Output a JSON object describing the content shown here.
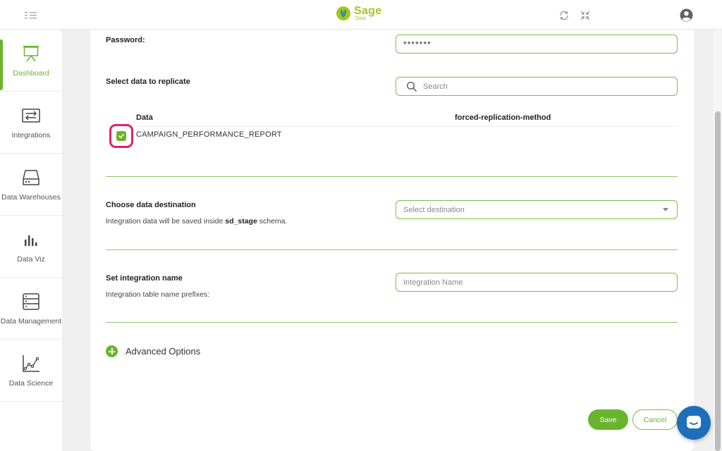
{
  "app": {
    "logo_name": "Sage",
    "logo_sub": "Data",
    "brand_color": "#a9c41e",
    "accent_color": "#6ab42d"
  },
  "topbar": {
    "icons": [
      "menu-icon",
      "refresh-icon",
      "collapse-icon",
      "user-avatar-icon"
    ]
  },
  "sidebar": {
    "items": [
      {
        "label": "Dashboard",
        "icon": "presentation-board-icon",
        "active": true
      },
      {
        "label": "Integrations",
        "icon": "swap-arrows-icon",
        "active": false
      },
      {
        "label": "Data Warehouses",
        "icon": "hard-drive-icon",
        "active": false
      },
      {
        "label": "Data Viz",
        "icon": "bar-chart-icon",
        "active": false
      },
      {
        "label": "Data Management",
        "icon": "server-icon",
        "active": false
      },
      {
        "label": "Data Science",
        "icon": "scatter-line-icon",
        "active": false
      }
    ]
  },
  "form": {
    "password": {
      "label": "Password:",
      "value": "*******"
    },
    "replicate": {
      "label": "Select data to replicate",
      "search_placeholder": "Search"
    },
    "table": {
      "col_data": "Data",
      "col_method": "forced-replication-method",
      "rows": [
        {
          "name": "CAMPAIGN_PERFORMANCE_REPORT",
          "checked": true,
          "method": ""
        }
      ]
    },
    "destination": {
      "label": "Choose data destination",
      "sub_prefix": "Integration data will be saved inside ",
      "sub_schema": "sd_stage",
      "sub_suffix": " schema.",
      "placeholder": "Select destination"
    },
    "integration_name": {
      "label": "Set integration name",
      "sub": "Integration table name prefixes:",
      "placeholder": "Integration Name"
    },
    "advanced": {
      "label": "Advanced Options"
    },
    "buttons": {
      "save": "Save",
      "cancel": "Cancel"
    }
  }
}
